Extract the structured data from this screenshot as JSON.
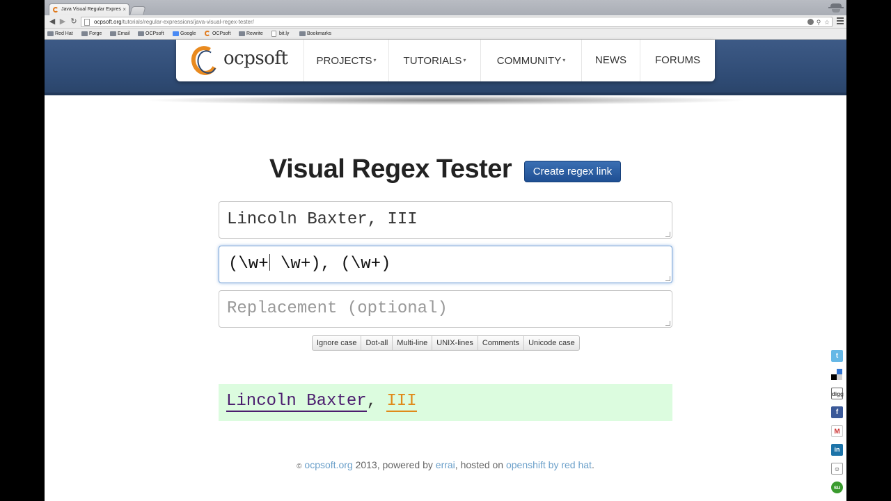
{
  "browser": {
    "tab_title": "Java Visual Regular Expres",
    "tab_close": "×",
    "url_domain": "ocpsoft.org",
    "url_path": "/tutorials/regular-expressions/java-visual-regex-tester/",
    "bookmarks": [
      {
        "label": "Red Hat",
        "icon": "folder-icon"
      },
      {
        "label": "Forge",
        "icon": "folder-icon"
      },
      {
        "label": "Email",
        "icon": "folder-icon"
      },
      {
        "label": "OCPsoft",
        "icon": "folder-icon"
      },
      {
        "label": "Google",
        "icon": "google-icon"
      },
      {
        "label": "OCPsoft",
        "icon": "ocpsoft-icon"
      },
      {
        "label": "Rewrite",
        "icon": "folder-icon"
      },
      {
        "label": "bit.ly",
        "icon": "page-icon"
      },
      {
        "label": "Bookmarks",
        "icon": "folder-icon"
      }
    ]
  },
  "site": {
    "logo_text": "ocpsoft",
    "nav": {
      "projects": "PROJECTS",
      "tutorials": "TUTORIALS",
      "community": "COMMUNITY",
      "news": "NEWS",
      "forums": "FORUMS"
    },
    "caret": "▾"
  },
  "tester": {
    "title": "Visual Regex Tester",
    "create_link_label": "Create regex link",
    "text_value": "Lincoln Baxter, III",
    "regex_before_cursor": "(\\w+",
    "regex_after_cursor": " \\w+), (\\w+)",
    "replacement_placeholder": "Replacement (optional)",
    "flags": [
      "Ignore case",
      "Dot-all",
      "Multi-line",
      "UNIX-lines",
      "Comments",
      "Unicode case"
    ],
    "result": {
      "group1": "Lincoln Baxter",
      "separator": ", ",
      "group2": "III"
    }
  },
  "footer": {
    "copyright_symbol": "©",
    "site_link": "ocpsoft.org",
    "year_text": " 2013, powered by ",
    "errai_link": "errai",
    "hosted_text": ", hosted on ",
    "openshift_link": "openshift by red hat",
    "end": "."
  },
  "share": {
    "twitter": "t",
    "facebook": "f",
    "gmail": "M",
    "linkedin": "in",
    "digg": "digg",
    "reddit": "☺",
    "stumbleupon": "su"
  },
  "colors": {
    "header_blue": "#2f4b74",
    "button_blue": "#1f4f93",
    "match_purple": "#4b1d6e",
    "match_orange": "#e08a1a",
    "result_green": "#dcfcdf",
    "link_blue": "#6a9fc9"
  }
}
